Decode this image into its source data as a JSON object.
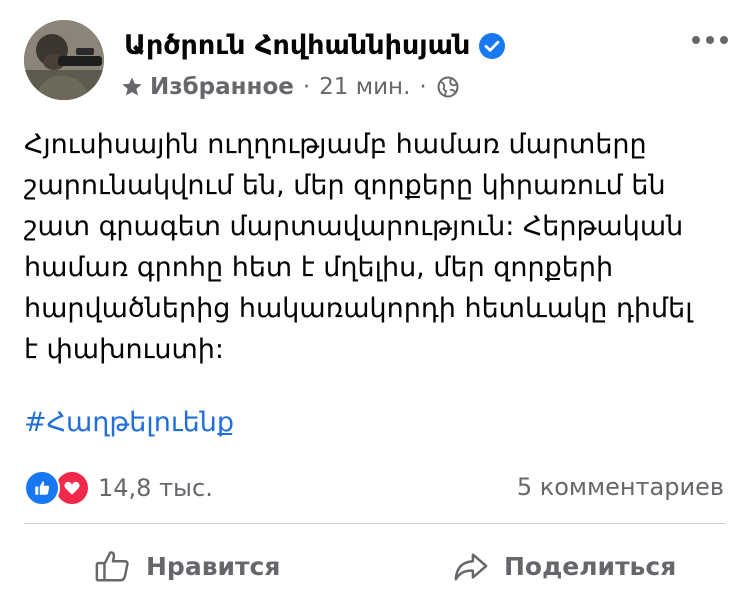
{
  "post": {
    "author": "Արծրուն Հովհաննիսյան",
    "favorites_label": "Избранное",
    "time": "21 мин.",
    "separator": "·",
    "text_lines": [
      "Հյուսիսային ուղղությամբ համառ մարտերը",
      "շարունակվում են, մեր զորքերը կիրառում են",
      "շատ գրագետ մարտավարություն: Հերթական",
      "համառ գրոհը հետ է մղելիս, մեր զորքերի",
      "հարվածներից հակառակորդի հետևակը դիմել",
      "է փախուստի:"
    ],
    "hashtag": "#Հաղթելուենք"
  },
  "stats": {
    "reactions_count": "14,8 тыс.",
    "comments": "5 комментариев"
  },
  "actions": {
    "like_label": "Нравится",
    "share_label": "Поделиться"
  },
  "colors": {
    "link": "#216fdb",
    "verified": "#1877f2",
    "like_reaction": "#1877f2",
    "love_reaction": "#f0284a",
    "secondary_text": "#65676b"
  },
  "icons": {
    "verified": "verified-badge-icon",
    "favorite": "star-icon",
    "audience": "globe-icon",
    "more": "more-options-icon",
    "like_reaction": "like-reaction-icon",
    "love_reaction": "love-reaction-icon",
    "like_action": "thumbs-up-icon",
    "share_action": "share-arrow-icon"
  }
}
